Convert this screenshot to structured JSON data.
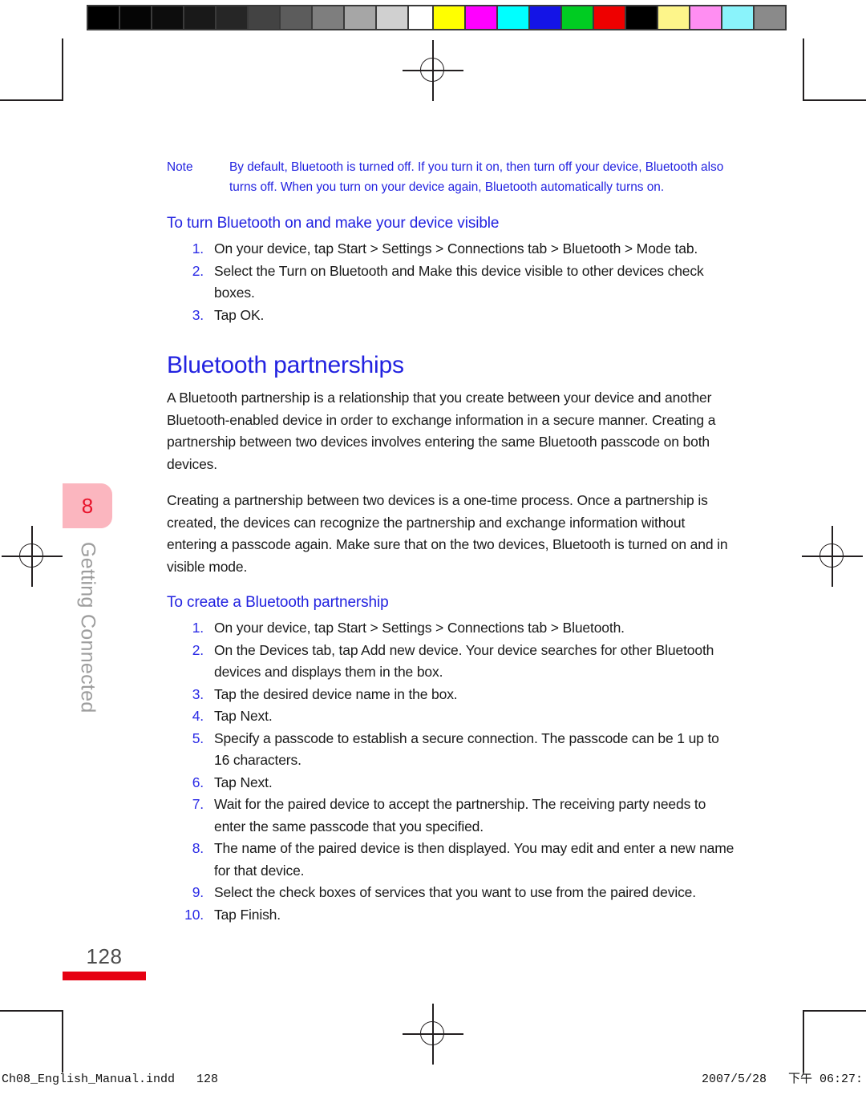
{
  "calibration": {
    "grayscale_patches": [
      "#000000",
      "#050505",
      "#0d0d0d",
      "#191919",
      "#262626",
      "#434343",
      "#5c5c5c",
      "#7e7e7e",
      "#a6a6a6",
      "#d0d0d0",
      "#ffffff"
    ],
    "color_patches": [
      "#ffff00",
      "#ff00ff",
      "#00ffff",
      "#1414e6",
      "#00cc22",
      "#ee0000",
      "#000000",
      "#fdf58a",
      "#ff8ef2",
      "#8af3fb",
      "#8a8a8a"
    ]
  },
  "note": {
    "label": "Note",
    "text": "By default, Bluetooth is turned off. If you turn it on, then turn off your device, Bluetooth also turns off. When you turn on your device again, Bluetooth automatically turns on."
  },
  "heading_visible": "To turn Bluetooth on and make your device visible",
  "steps_visible": [
    {
      "num": "1.",
      "text": "On your device, tap Start > Settings > Connections tab > Bluetooth > Mode tab."
    },
    {
      "num": "2.",
      "text": "Select the Turn on Bluetooth and Make this device visible to other devices check boxes."
    },
    {
      "num": "3.",
      "text": "Tap OK."
    }
  ],
  "section_heading": "Bluetooth partnerships",
  "paragraphs": [
    "A Bluetooth partnership is a relationship that you create between your device and another Bluetooth-enabled device in order to exchange information in a secure manner. Creating a partnership between two devices involves entering the same Bluetooth passcode on both devices.",
    "Creating a partnership between two devices is a one-time process. Once a partnership is created, the devices can recognize the partnership and exchange information without entering a passcode again. Make sure that on the two devices, Bluetooth is turned on and in visible mode."
  ],
  "heading_partnership": "To create a Bluetooth partnership",
  "steps_partnership": [
    {
      "num": "1.",
      "text": "On your device, tap Start > Settings > Connections tab > Bluetooth."
    },
    {
      "num": "2.",
      "text": "On the Devices tab, tap Add new device. Your device searches for other Bluetooth devices and displays them in the box."
    },
    {
      "num": "3.",
      "text": "Tap the desired device name in the box."
    },
    {
      "num": "4.",
      "text": "Tap Next."
    },
    {
      "num": "5.",
      "text": "Specify a passcode to establish a secure connection. The passcode can be 1 up to 16 characters."
    },
    {
      "num": "6.",
      "text": "Tap Next."
    },
    {
      "num": "7.",
      "text": "Wait for the paired device to accept the partnership. The receiving party needs to enter the same passcode that you specified."
    },
    {
      "num": "8.",
      "text": "The name of the paired device is then displayed. You may edit and enter a new name for that device."
    },
    {
      "num": "9.",
      "text": "Select the check boxes of services that you want to use from the paired device."
    },
    {
      "num": "10.",
      "text": "Tap Finish."
    }
  ],
  "chapter": {
    "number": "8",
    "name": "Getting Connected"
  },
  "page_number": "128",
  "scan_footer": {
    "left": "Ch08_English_Manual.indd   128",
    "right": "2007/5/28   下午 06:27:"
  },
  "colors": {
    "heading_blue": "#2222e0",
    "body_black": "#1a1a1a",
    "chapter_tab_pink": "#fbb6bf",
    "chapter_number_red": "#e8132b",
    "page_bar_red": "#e60012",
    "chapter_name_gray": "#9d9d9d"
  }
}
